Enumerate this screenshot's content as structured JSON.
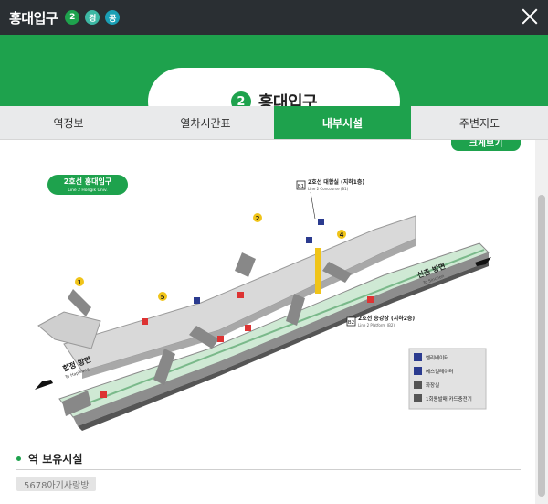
{
  "window": {
    "title": "홍대입구",
    "line_badge": "2",
    "badge_g1": "경",
    "badge_g2": "공",
    "close_icon": "close-icon"
  },
  "station": {
    "line": "2",
    "name": "홍대입구"
  },
  "tabs": [
    {
      "label": "역정보"
    },
    {
      "label": "열차시간표"
    },
    {
      "label": "내부시설",
      "active": true
    },
    {
      "label": "주변지도"
    }
  ],
  "content": {
    "big_view_button": "크게보기",
    "map": {
      "station_tag": "2호선 홍대입구",
      "station_tag_en": "Line 2 Hongik Univ.",
      "b1_label": "2호선 대합실 (지하1층)",
      "b1_sub": "Line 2 Concourse (B1)",
      "b2_label": "2호선 승강장 (지하2층)",
      "b2_sub": "Line 2 Platform (B2)",
      "b1_code": "B1",
      "b2_code": "B2",
      "dir_left": "합정 방면",
      "dir_left_en": "To Hapjeong",
      "dir_right": "신촌 방면",
      "dir_right_en": "To Sinchon",
      "exit_labels": [
        "1",
        "2",
        "4",
        "5"
      ],
      "legend": [
        {
          "icon": "elevator-icon",
          "label": "엘리베이터"
        },
        {
          "icon": "escalator-icon",
          "label": "에스컬레이터"
        },
        {
          "icon": "restroom-icon",
          "label": "화장실"
        },
        {
          "icon": "ticket-machine-icon",
          "label": "1회용발매·카드충전기"
        }
      ]
    },
    "facilities": {
      "heading": "역 보유시설",
      "items": [
        "5678아기사랑방"
      ]
    }
  },
  "colors": {
    "brand_green": "#1ea24d",
    "title_bar": "#2a2f33",
    "exit_yellow": "#f0c419"
  }
}
